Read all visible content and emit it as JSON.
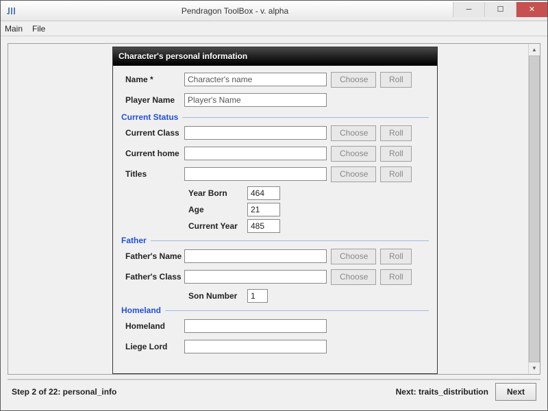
{
  "window": {
    "title": "Pendragon ToolBox - v. alpha"
  },
  "menu": {
    "main": "Main",
    "file": "File"
  },
  "panel": {
    "title": "Character's personal information"
  },
  "labels": {
    "name": "Name *",
    "player_name": "Player Name",
    "current_class": "Current Class",
    "current_home": "Current home",
    "titles": "Titles",
    "year_born": "Year Born",
    "age": "Age",
    "current_year": "Current Year",
    "fathers_name": "Father's Name",
    "fathers_class": "Father's Class",
    "son_number": "Son Number",
    "homeland": "Homeland",
    "liege_lord": "Liege Lord"
  },
  "sections": {
    "current_status": "Current Status",
    "father": "Father",
    "homeland": "Homeland"
  },
  "values": {
    "name": "Character's name",
    "player_name": "Player's Name",
    "current_class": "",
    "current_home": "",
    "titles": "",
    "year_born": "464",
    "age": "21",
    "current_year": "485",
    "fathers_name": "",
    "fathers_class": "",
    "son_number": "1",
    "homeland": "",
    "liege_lord": ""
  },
  "buttons": {
    "choose": "Choose",
    "roll": "Roll",
    "next": "Next"
  },
  "footer": {
    "step": "Step 2 of 22: personal_info",
    "next_label": "Next: traits_distribution"
  }
}
